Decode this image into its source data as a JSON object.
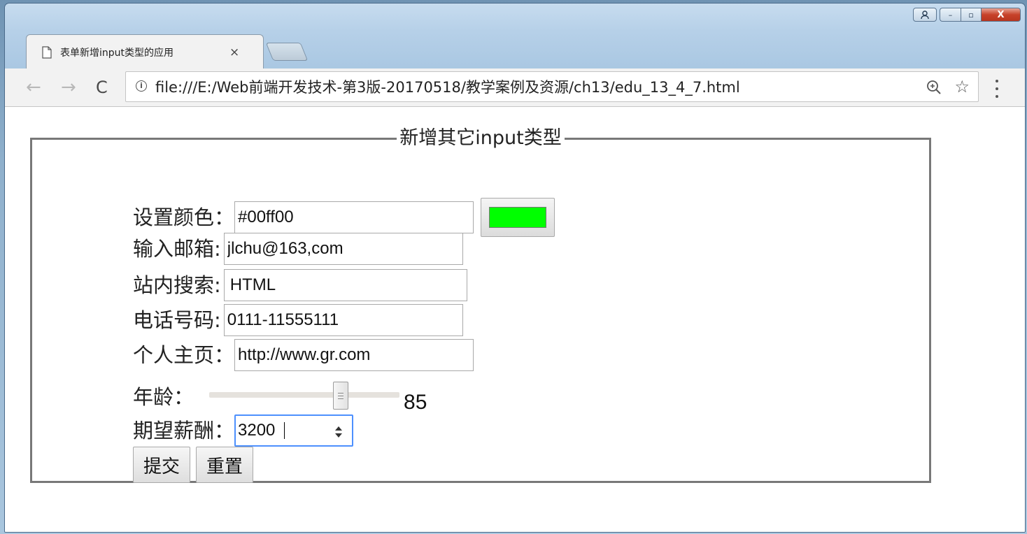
{
  "browser": {
    "tab_title": "表单新增input类型的应用",
    "tab_close": "×",
    "url": "file:///E:/Web前端开发技术-第3版-20170518/教学案例及资源/ch13/edu_13_4_7.html",
    "back_glyph": "←",
    "forward_glyph": "→",
    "reload_glyph": "C",
    "star_glyph": "☆",
    "info_glyph": "i",
    "window_controls": {
      "minimize": "–",
      "maximize": "▫",
      "close": "X"
    }
  },
  "form": {
    "legend": "新增其它input类型",
    "color": {
      "label": "设置颜色：",
      "value": "#00ff00",
      "swatch": "#00ff00"
    },
    "email": {
      "label": "输入邮箱:",
      "value": "jlchu@163,com"
    },
    "search": {
      "label": "站内搜索:",
      "value": "HTML"
    },
    "tel": {
      "label": "电话号码:",
      "value": "0111-11555111"
    },
    "url": {
      "label": "个人主页：",
      "value": "http://www.gr.com"
    },
    "age": {
      "label": "年龄：",
      "value": "85",
      "fraction": 0.69
    },
    "salary": {
      "label": "期望薪酬：",
      "value": "3200"
    },
    "buttons": {
      "submit": "提交",
      "reset": "重置"
    }
  },
  "colors": {
    "focus_ring": "#4d90fe",
    "close_button": "#c7422a",
    "legend_border": "#787878"
  },
  "icons": [
    "page-icon",
    "info-icon",
    "zoom-icon",
    "star-icon",
    "menu-icon",
    "spinner-icon",
    "user-icon"
  ]
}
